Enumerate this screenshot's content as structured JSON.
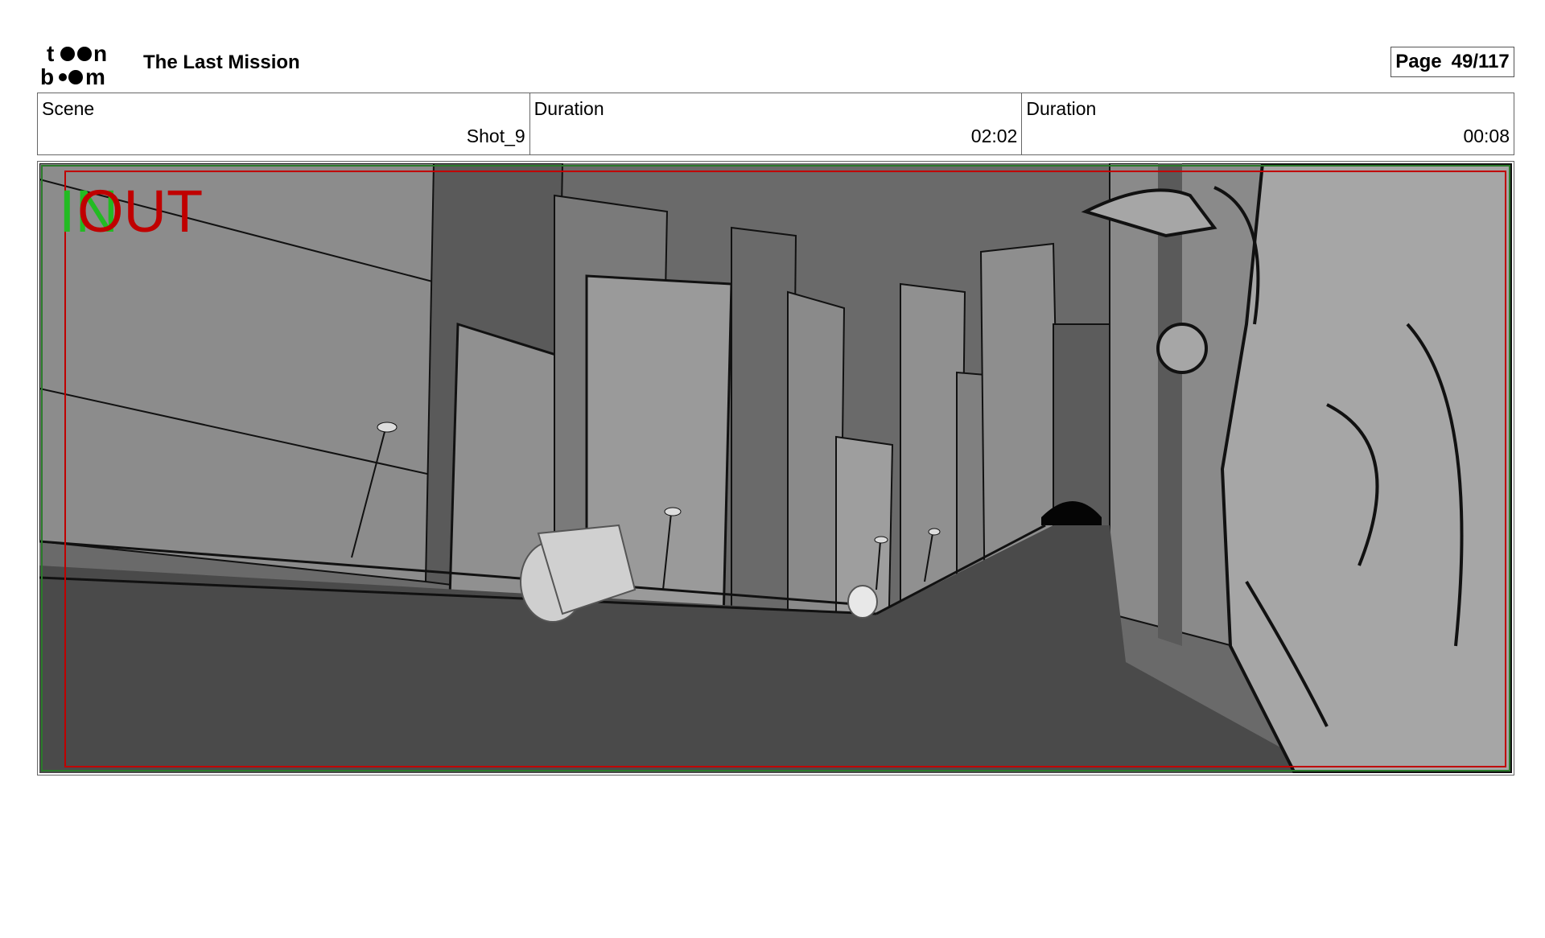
{
  "header": {
    "logo_text": "toon boom",
    "title": "The Last Mission",
    "page_label": "Page",
    "page_value": "49/117"
  },
  "info": [
    {
      "label": "Scene",
      "value": "Shot_9"
    },
    {
      "label": "Duration",
      "value": "02:02"
    },
    {
      "label": "Duration",
      "value": "00:08"
    }
  ],
  "panel": {
    "in_marker": "IN",
    "out_marker": "OUT",
    "in_color": "#22bb22",
    "out_color": "#c00000"
  }
}
